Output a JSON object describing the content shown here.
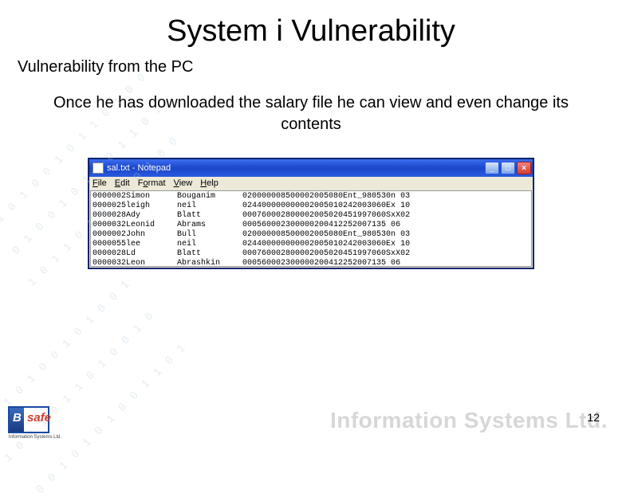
{
  "slide": {
    "title": "System i Vulnerability",
    "subtitle": "Vulnerability from the PC",
    "body": "Once he has downloaded the salary file he can view and even change its contents",
    "page_number": "12"
  },
  "notepad": {
    "window_title": "sal.txt - Notepad",
    "menus": {
      "file": "File",
      "edit": "Edit",
      "format": "Format",
      "view": "View",
      "help": "Help"
    },
    "col1": "0000002Simon\n0000025leigh\n0000028Ady\n0000032Leonid\n0000002John\n0000055lee\n0000028Ld\n0000032Leon",
    "col2": "Bouganim\nneil\nBlatt\nAbrams\nBull\nneil\nBlatt\nAbrashkin",
    "col3": "020000008500002005080Ent_980530n 03\n024400000000002005010242003060Ex 10\n000760002800002005020451997060SxX02\n000560002300000200412252007135 06\n020000008500002005080Ent_980530n 03\n024400000000002005010242003060Ex 10\n000760002800002005020451997060SxX02\n000560002300000200412252007135 06"
  },
  "watermark": "Information Systems Ltd.",
  "logo_caption": "Information Systems Ltd."
}
